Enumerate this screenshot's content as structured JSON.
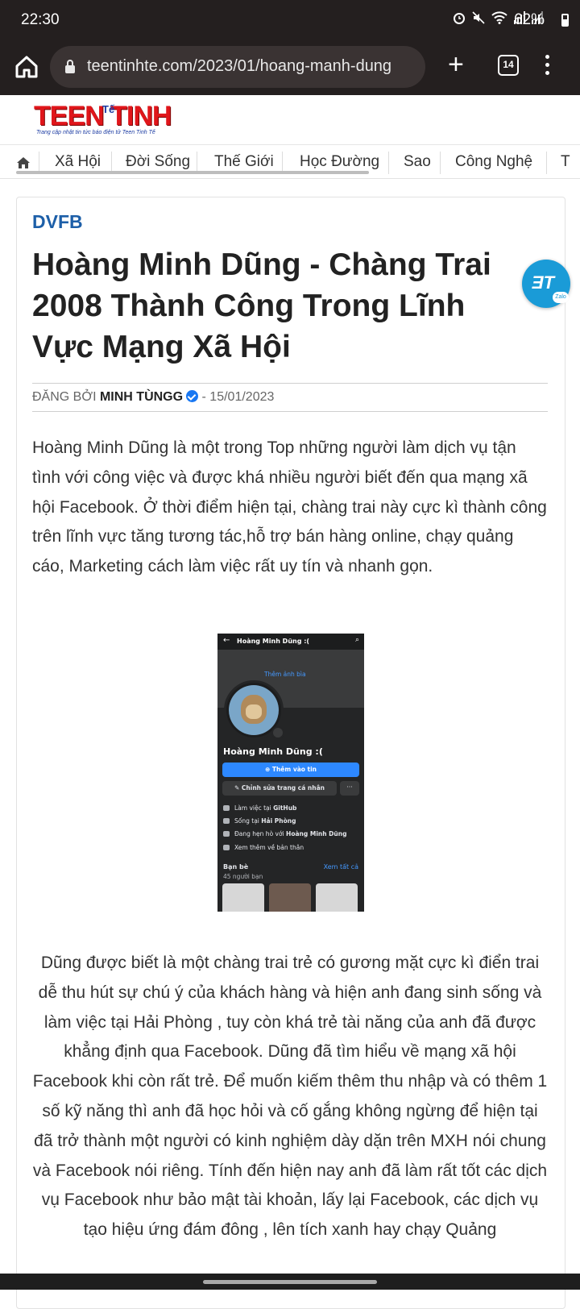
{
  "status": {
    "time": "22:30",
    "battery": "62%"
  },
  "browser": {
    "url": "teentinhte.com/2023/01/hoang-manh-dung",
    "tab_count": "14"
  },
  "site": {
    "logo_text": "TEEN TINH",
    "logo_small": "Tế",
    "logo_tagline": "Trang cập nhật tin tức báo điện tử Teen Tinh Tế"
  },
  "nav": {
    "items": [
      "Xã Hội",
      "Đời Sống",
      "Thế Giới",
      "Học Đường",
      "Sao",
      "Công Nghệ",
      "T"
    ]
  },
  "article": {
    "category": "DVFB",
    "title": "Hoàng Minh Dũng - Chàng Trai 2008 Thành Công Trong Lĩnh Vực Mạng Xã Hội",
    "posted_by_label": "ĐĂNG BỞI",
    "author": "MINH TÙNGG",
    "date": "- 15/01/2023",
    "paragraph1": "Hoàng Minh Dũng là một trong Top những người làm dịch vụ tận tình với công việc và được khá nhiều người biết đến qua mạng xã hội Facebook. Ở thời điểm hiện tại, chàng trai này cực kì thành công trên lĩnh vực tăng tương tác,hỗ trợ bán hàng online, chạy quảng cáo, Marketing cách làm việc rất uy tín và nhanh gọn.",
    "paragraph2": "Dũng được biết là một chàng trai trẻ có gương mặt cực kì điển trai dễ thu hút sự chú ý của khách hàng và hiện anh đang sinh sống và làm việc tại Hải Phòng , tuy còn khá trẻ tài năng của anh đã được khẳng định qua Facebook. Dũng đã tìm hiểu về mạng xã hội Facebook khi còn rất trẻ. Để muốn kiếm thêm thu nhập và có thêm 1 số kỹ năng thì anh đã học hỏi và cố gắng không ngừng để hiện tại đã trở thành một người có kinh nghiệm dày dặn trên MXH nói chung và Facebook nói riêng. Tính đến hiện nay anh đã làm rất tốt các dịch vụ Facebook như bảo mật tài khoản, lấy lại Facebook, các dịch vụ tạo hiệu ứng đám đông , lên tích xanh hay chạy Quảng"
  },
  "fb_screenshot": {
    "header_name": "Hoàng Minh Dũng :(",
    "add_cover": "Thêm ảnh bìa",
    "profile_name": "Hoàng Minh Dũng :(",
    "add_story": "⊕ Thêm vào tin",
    "edit_profile": "✎ Chỉnh sửa trang cá nhân",
    "more": "···",
    "work_prefix": "Làm việc tại ",
    "work": "GitHub",
    "live_prefix": "Sống tại ",
    "live": "Hải Phòng",
    "dating_prefix": "Đang hẹn hò với ",
    "dating": "Hoàng Minh Dũng",
    "see_more": "Xem thêm về bản thân",
    "friends_label": "Bạn bè",
    "friends_see_all": "Xem tất cả",
    "friends_count": "45 người bạn"
  },
  "zalo": {
    "mark": "ƎT",
    "tag": "Zalo"
  },
  "icons": {
    "home": "home-icon",
    "lock": "lock-icon",
    "plus": "plus-icon",
    "tabs": "tabs-icon",
    "menu": "more-vert-icon",
    "verified": "verified-icon"
  },
  "colors": {
    "status_bar": "#241f1f",
    "category": "#1d5fa8",
    "logo_red": "#e0161b",
    "verified": "#1877f2",
    "fb_blue": "#2d88ff"
  }
}
